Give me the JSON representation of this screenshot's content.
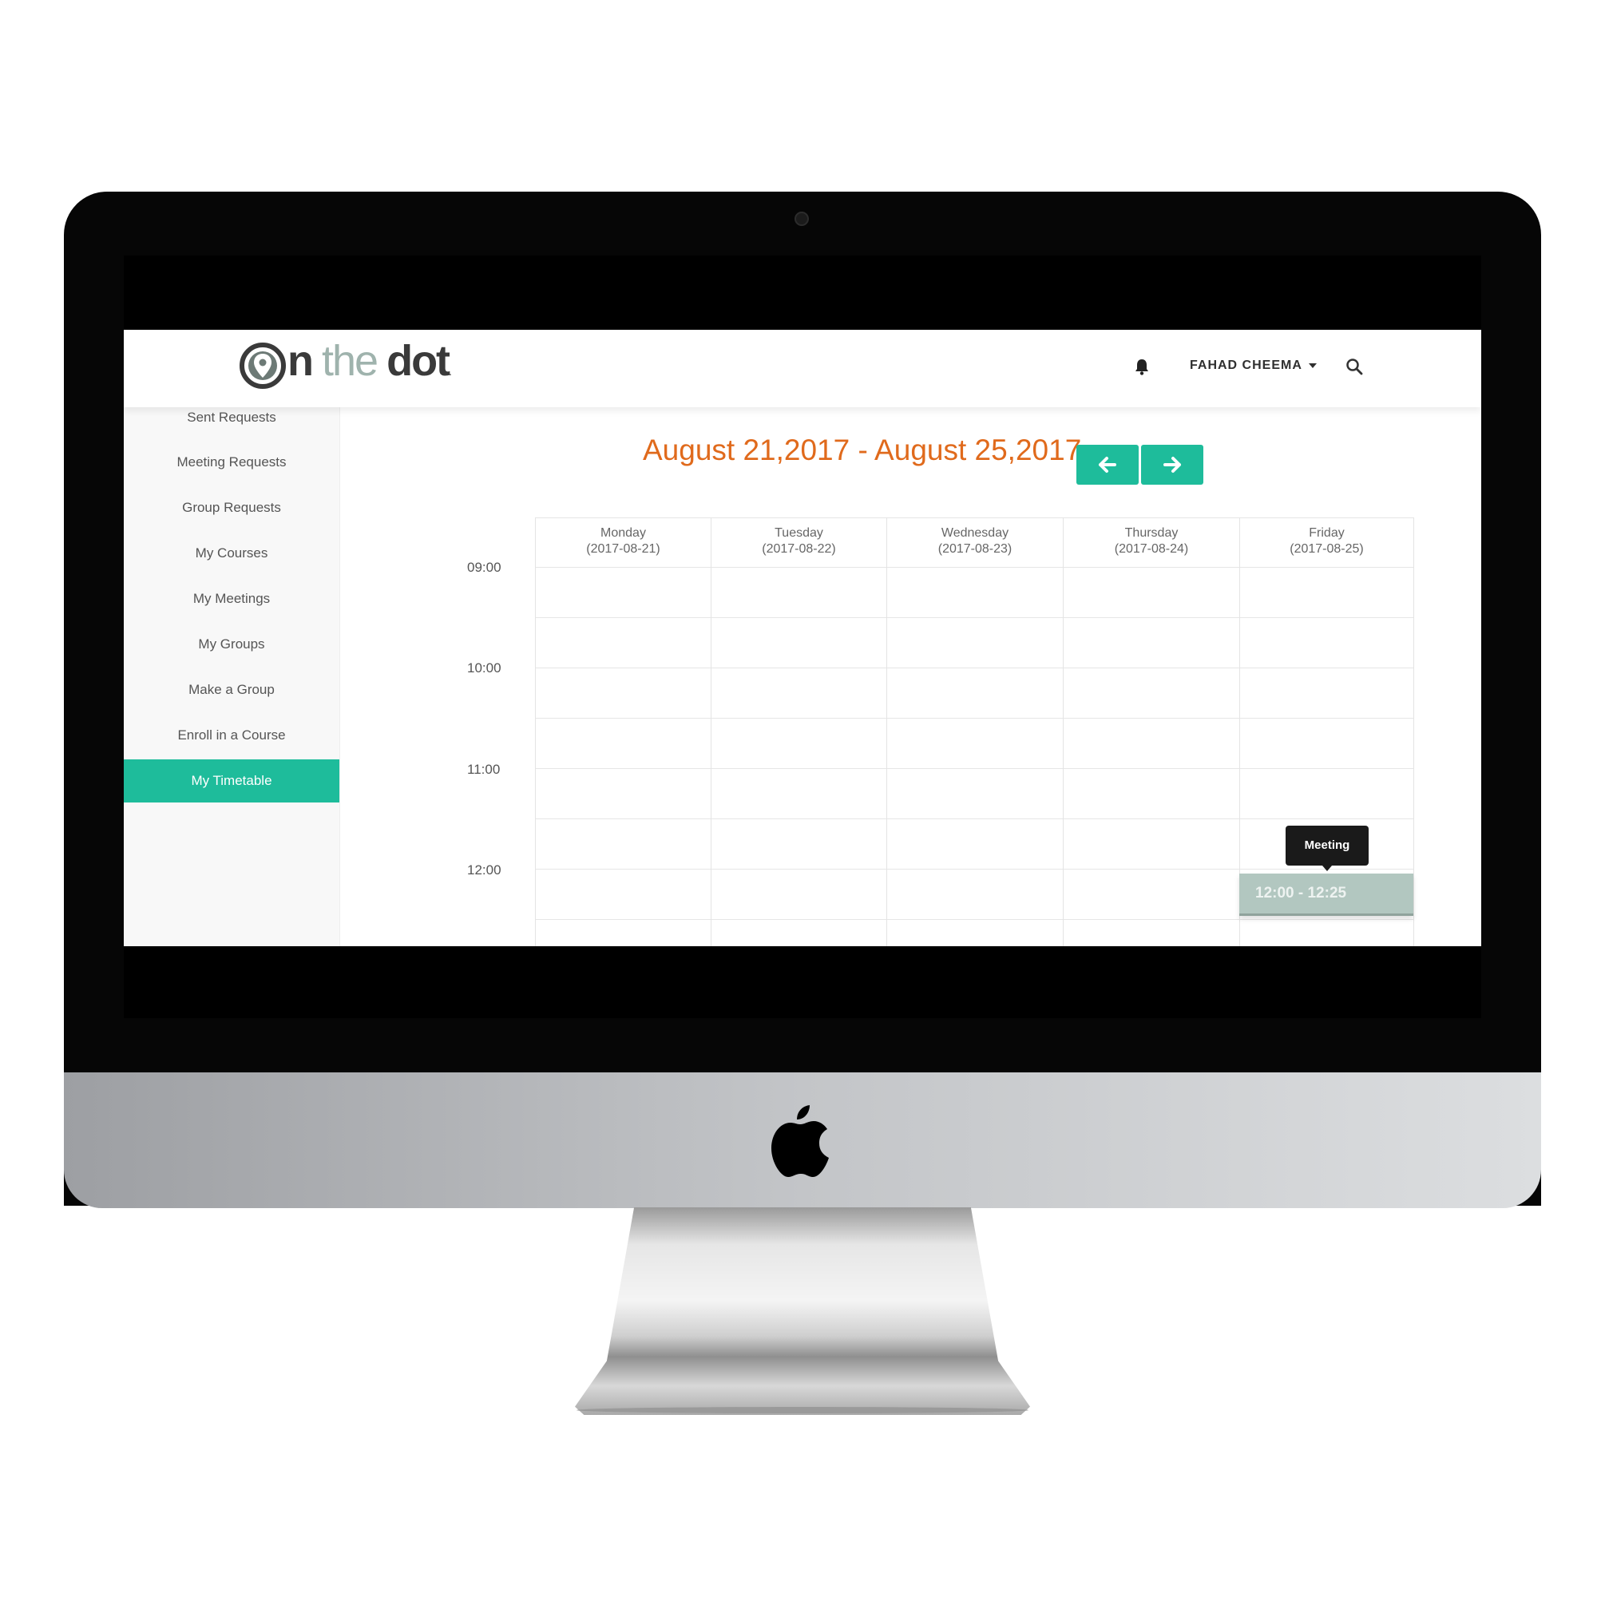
{
  "brand": {
    "logo_n": "n",
    "logo_the": "the",
    "logo_dot": "dot",
    "logo_trailing": "."
  },
  "header": {
    "bell_icon": "bell-icon",
    "user_name": "FAHAD CHEEMA",
    "search_icon": "search-icon"
  },
  "sidebar": {
    "items": [
      {
        "label": "Sent Requests"
      },
      {
        "label": "Meeting Requests"
      },
      {
        "label": "Group Requests"
      },
      {
        "label": "My Courses"
      },
      {
        "label": "My Meetings"
      },
      {
        "label": "My Groups"
      },
      {
        "label": "Make a Group"
      },
      {
        "label": "Enroll in a Course"
      },
      {
        "label": "My Timetable",
        "active": true
      }
    ]
  },
  "timetable": {
    "week_title": "August 21,2017 - August 25,2017",
    "prev_icon": "arrow-left-icon",
    "next_icon": "arrow-right-icon",
    "days": [
      {
        "name": "Monday",
        "date": "(2017-08-21)"
      },
      {
        "name": "Tuesday",
        "date": "(2017-08-22)"
      },
      {
        "name": "Wednesday",
        "date": "(2017-08-23)"
      },
      {
        "name": "Thursday",
        "date": "(2017-08-24)"
      },
      {
        "name": "Friday",
        "date": "(2017-08-25)"
      }
    ],
    "times": [
      "09:00",
      "10:00",
      "11:00",
      "12:00"
    ],
    "event": {
      "time": "12:00 - 12:25",
      "tooltip": "Meeting",
      "day": "Friday"
    }
  },
  "colors": {
    "accent": "#1ebc9b",
    "title": "#e06a1c",
    "event": "#b2c7c0"
  }
}
